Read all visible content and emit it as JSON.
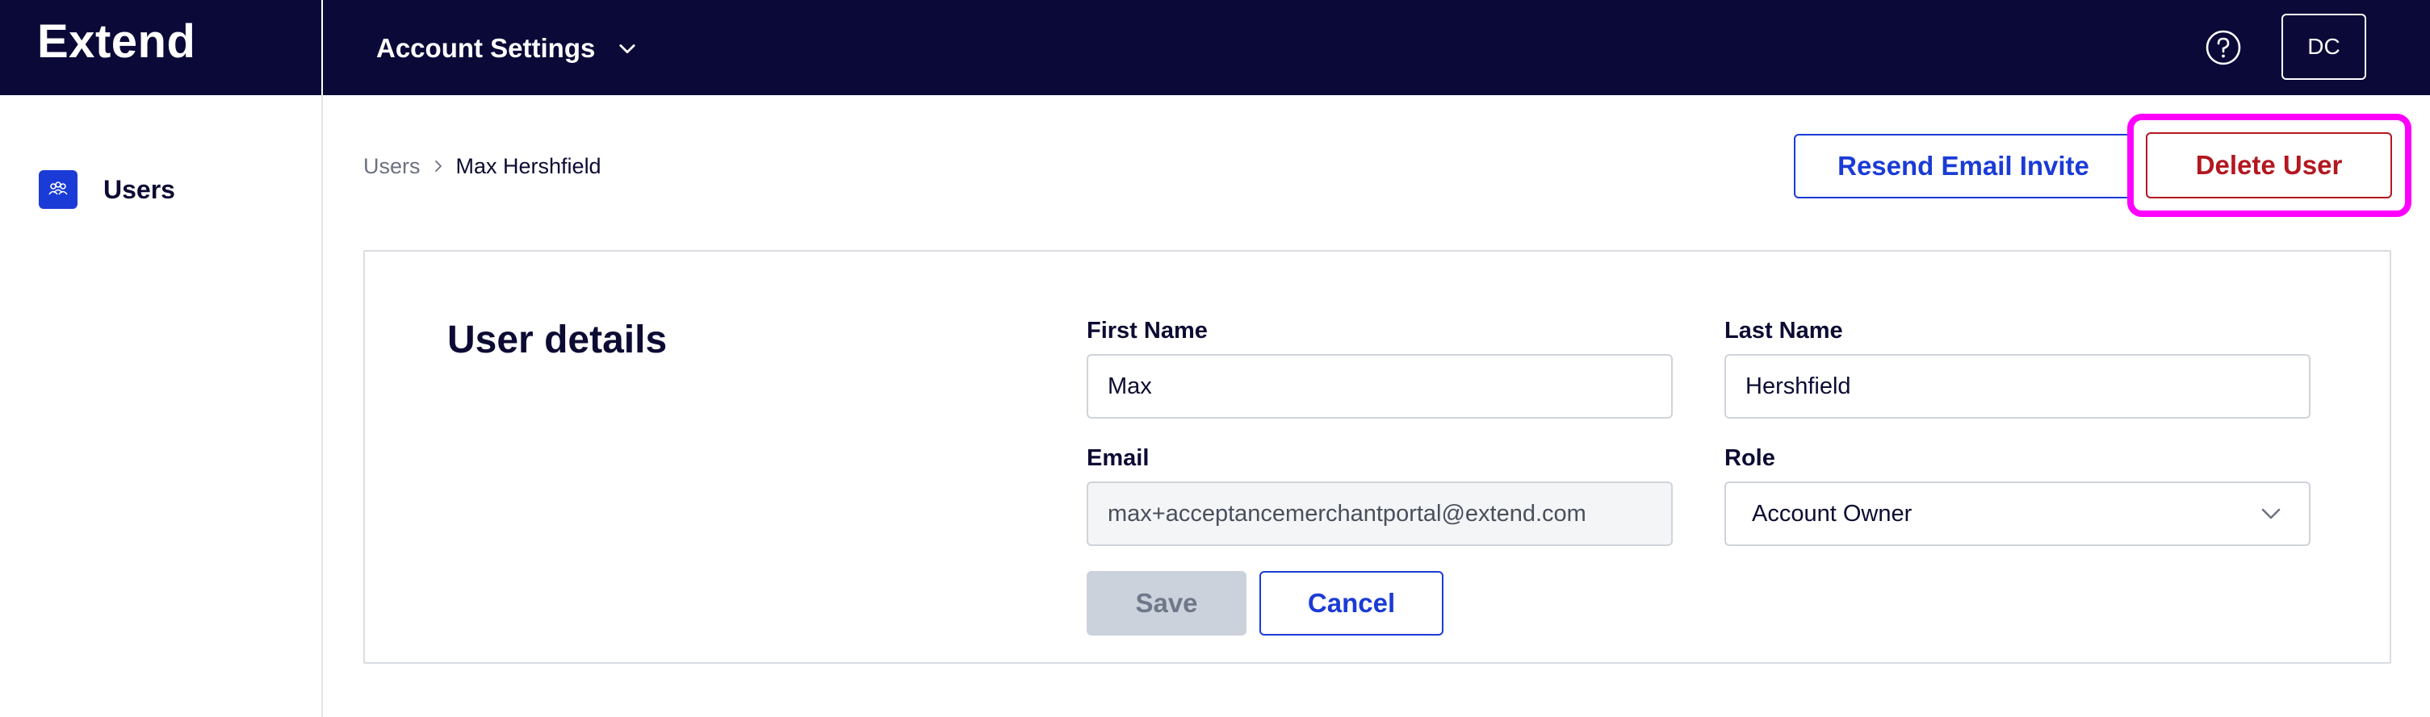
{
  "header": {
    "logo": "Extend",
    "account_menu_label": "Account Settings",
    "avatar_initials": "DC"
  },
  "sidebar": {
    "items": [
      {
        "label": "Users",
        "icon": "users-icon"
      }
    ]
  },
  "breadcrumb": {
    "parent": "Users",
    "current": "Max Hershfield"
  },
  "actions": {
    "resend_label": "Resend Email Invite",
    "delete_label": "Delete User"
  },
  "form": {
    "title": "User details",
    "first_name": {
      "label": "First Name",
      "value": "Max"
    },
    "last_name": {
      "label": "Last Name",
      "value": "Hershfield"
    },
    "email": {
      "label": "Email",
      "value": "max+acceptancemerchantportal@extend.com"
    },
    "role": {
      "label": "Role",
      "value": "Account Owner"
    },
    "save_label": "Save",
    "cancel_label": "Cancel"
  },
  "colors": {
    "header_bg": "#0b0938",
    "accent": "#1b3bd6",
    "danger": "#b3171f",
    "highlight": "#ff00ff"
  }
}
